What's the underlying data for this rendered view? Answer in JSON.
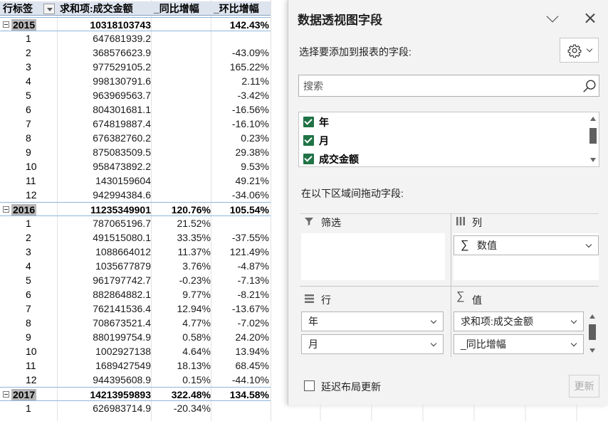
{
  "pivot_table": {
    "headers": [
      "行标签",
      "求和项:成交金额",
      "_同比增幅",
      "_环比增幅"
    ],
    "rows": [
      {
        "type": "year",
        "label": "2015",
        "amount": "10318103743",
        "yoy": "",
        "mom": "142.43%"
      },
      {
        "type": "month",
        "label": "1",
        "amount": "647681939.2",
        "yoy": "",
        "mom": ""
      },
      {
        "type": "month",
        "label": "2",
        "amount": "368576623.9",
        "yoy": "",
        "mom": "-43.09%"
      },
      {
        "type": "month",
        "label": "3",
        "amount": "977529105.2",
        "yoy": "",
        "mom": "165.22%"
      },
      {
        "type": "month",
        "label": "4",
        "amount": "998130791.6",
        "yoy": "",
        "mom": "2.11%"
      },
      {
        "type": "month",
        "label": "5",
        "amount": "963969563.7",
        "yoy": "",
        "mom": "-3.42%"
      },
      {
        "type": "month",
        "label": "6",
        "amount": "804301681.1",
        "yoy": "",
        "mom": "-16.56%"
      },
      {
        "type": "month",
        "label": "7",
        "amount": "674819887.4",
        "yoy": "",
        "mom": "-16.10%"
      },
      {
        "type": "month",
        "label": "8",
        "amount": "676382760.2",
        "yoy": "",
        "mom": "0.23%"
      },
      {
        "type": "month",
        "label": "9",
        "amount": "875083509.5",
        "yoy": "",
        "mom": "29.38%"
      },
      {
        "type": "month",
        "label": "10",
        "amount": "958473892.2",
        "yoy": "",
        "mom": "9.53%"
      },
      {
        "type": "month",
        "label": "11",
        "amount": "1430159604",
        "yoy": "",
        "mom": "49.21%"
      },
      {
        "type": "month",
        "label": "12",
        "amount": "942994384.6",
        "yoy": "",
        "mom": "-34.06%"
      },
      {
        "type": "year",
        "label": "2016",
        "amount": "11235349901",
        "yoy": "120.76%",
        "mom": "105.54%"
      },
      {
        "type": "month",
        "label": "1",
        "amount": "787065196.7",
        "yoy": "21.52%",
        "mom": ""
      },
      {
        "type": "month",
        "label": "2",
        "amount": "491515080.1",
        "yoy": "33.35%",
        "mom": "-37.55%"
      },
      {
        "type": "month",
        "label": "3",
        "amount": "1088664012",
        "yoy": "11.37%",
        "mom": "121.49%"
      },
      {
        "type": "month",
        "label": "4",
        "amount": "1035677879",
        "yoy": "3.76%",
        "mom": "-4.87%"
      },
      {
        "type": "month",
        "label": "5",
        "amount": "961797742.7",
        "yoy": "-0.23%",
        "mom": "-7.13%"
      },
      {
        "type": "month",
        "label": "6",
        "amount": "882864882.1",
        "yoy": "9.77%",
        "mom": "-8.21%"
      },
      {
        "type": "month",
        "label": "7",
        "amount": "762141536.4",
        "yoy": "12.94%",
        "mom": "-13.67%"
      },
      {
        "type": "month",
        "label": "8",
        "amount": "708673521.4",
        "yoy": "4.77%",
        "mom": "-7.02%"
      },
      {
        "type": "month",
        "label": "9",
        "amount": "880199754.9",
        "yoy": "0.58%",
        "mom": "24.20%"
      },
      {
        "type": "month",
        "label": "10",
        "amount": "1002927138",
        "yoy": "4.64%",
        "mom": "13.94%"
      },
      {
        "type": "month",
        "label": "11",
        "amount": "1689427549",
        "yoy": "18.13%",
        "mom": "68.45%"
      },
      {
        "type": "month",
        "label": "12",
        "amount": "944395608.9",
        "yoy": "0.15%",
        "mom": "-44.10%"
      },
      {
        "type": "year",
        "label": "2017",
        "amount": "14213959893",
        "yoy": "322.48%",
        "mom": "134.58%"
      },
      {
        "type": "month",
        "label": "1",
        "amount": "626983714.9",
        "yoy": "-20.34%",
        "mom": ""
      }
    ]
  },
  "pane": {
    "title": "数据透视图字段",
    "choose_label": "选择要添加到报表的字段:",
    "search_placeholder": "搜索",
    "fields": [
      {
        "label": "年",
        "checked": true
      },
      {
        "label": "月",
        "checked": true
      },
      {
        "label": "成交金额",
        "checked": true
      }
    ],
    "drag_label": "在以下区域间拖动字段:",
    "areas": {
      "filter": {
        "title": "筛选"
      },
      "columns": {
        "title": "列",
        "items": [
          "数值"
        ]
      },
      "rows": {
        "title": "行",
        "items": [
          "年",
          "月"
        ]
      },
      "values": {
        "title": "值",
        "items": [
          "求和项:成交金额",
          "_同比增幅"
        ]
      }
    },
    "defer_label": "延迟布局更新",
    "update_label": "更新",
    "defer_checked": false
  },
  "colors": {
    "accent_green": "#217346",
    "header_bg": "#dde4ee"
  }
}
